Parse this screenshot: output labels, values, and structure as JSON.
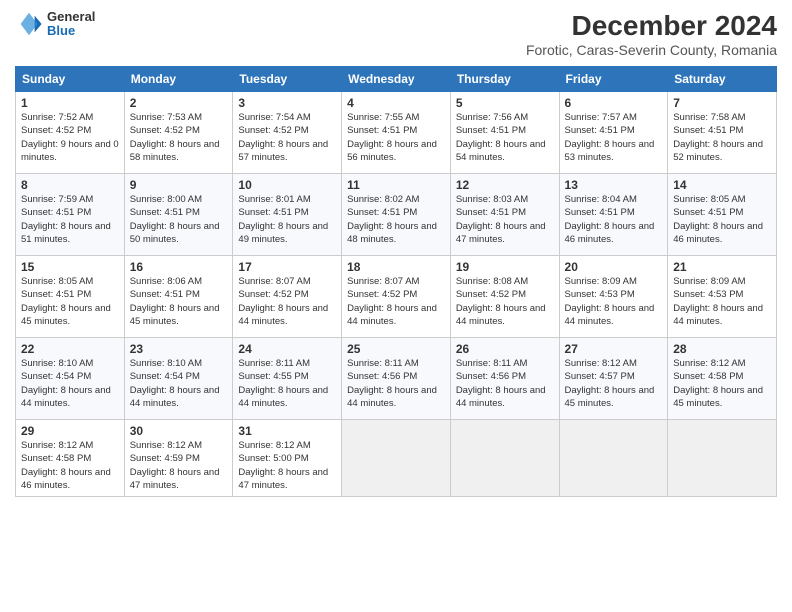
{
  "header": {
    "logo": {
      "general": "General",
      "blue": "Blue"
    },
    "title": "December 2024",
    "subtitle": "Forotic, Caras-Severin County, Romania"
  },
  "calendar": {
    "days_of_week": [
      "Sunday",
      "Monday",
      "Tuesday",
      "Wednesday",
      "Thursday",
      "Friday",
      "Saturday"
    ],
    "weeks": [
      [
        {
          "day": "1",
          "sunrise": "7:52 AM",
          "sunset": "4:52 PM",
          "daylight": "9 hours and 0 minutes."
        },
        {
          "day": "2",
          "sunrise": "7:53 AM",
          "sunset": "4:52 PM",
          "daylight": "8 hours and 58 minutes."
        },
        {
          "day": "3",
          "sunrise": "7:54 AM",
          "sunset": "4:52 PM",
          "daylight": "8 hours and 57 minutes."
        },
        {
          "day": "4",
          "sunrise": "7:55 AM",
          "sunset": "4:51 PM",
          "daylight": "8 hours and 56 minutes."
        },
        {
          "day": "5",
          "sunrise": "7:56 AM",
          "sunset": "4:51 PM",
          "daylight": "8 hours and 54 minutes."
        },
        {
          "day": "6",
          "sunrise": "7:57 AM",
          "sunset": "4:51 PM",
          "daylight": "8 hours and 53 minutes."
        },
        {
          "day": "7",
          "sunrise": "7:58 AM",
          "sunset": "4:51 PM",
          "daylight": "8 hours and 52 minutes."
        }
      ],
      [
        {
          "day": "8",
          "sunrise": "7:59 AM",
          "sunset": "4:51 PM",
          "daylight": "8 hours and 51 minutes."
        },
        {
          "day": "9",
          "sunrise": "8:00 AM",
          "sunset": "4:51 PM",
          "daylight": "8 hours and 50 minutes."
        },
        {
          "day": "10",
          "sunrise": "8:01 AM",
          "sunset": "4:51 PM",
          "daylight": "8 hours and 49 minutes."
        },
        {
          "day": "11",
          "sunrise": "8:02 AM",
          "sunset": "4:51 PM",
          "daylight": "8 hours and 48 minutes."
        },
        {
          "day": "12",
          "sunrise": "8:03 AM",
          "sunset": "4:51 PM",
          "daylight": "8 hours and 47 minutes."
        },
        {
          "day": "13",
          "sunrise": "8:04 AM",
          "sunset": "4:51 PM",
          "daylight": "8 hours and 46 minutes."
        },
        {
          "day": "14",
          "sunrise": "8:05 AM",
          "sunset": "4:51 PM",
          "daylight": "8 hours and 46 minutes."
        }
      ],
      [
        {
          "day": "15",
          "sunrise": "8:05 AM",
          "sunset": "4:51 PM",
          "daylight": "8 hours and 45 minutes."
        },
        {
          "day": "16",
          "sunrise": "8:06 AM",
          "sunset": "4:51 PM",
          "daylight": "8 hours and 45 minutes."
        },
        {
          "day": "17",
          "sunrise": "8:07 AM",
          "sunset": "4:52 PM",
          "daylight": "8 hours and 44 minutes."
        },
        {
          "day": "18",
          "sunrise": "8:07 AM",
          "sunset": "4:52 PM",
          "daylight": "8 hours and 44 minutes."
        },
        {
          "day": "19",
          "sunrise": "8:08 AM",
          "sunset": "4:52 PM",
          "daylight": "8 hours and 44 minutes."
        },
        {
          "day": "20",
          "sunrise": "8:09 AM",
          "sunset": "4:53 PM",
          "daylight": "8 hours and 44 minutes."
        },
        {
          "day": "21",
          "sunrise": "8:09 AM",
          "sunset": "4:53 PM",
          "daylight": "8 hours and 44 minutes."
        }
      ],
      [
        {
          "day": "22",
          "sunrise": "8:10 AM",
          "sunset": "4:54 PM",
          "daylight": "8 hours and 44 minutes."
        },
        {
          "day": "23",
          "sunrise": "8:10 AM",
          "sunset": "4:54 PM",
          "daylight": "8 hours and 44 minutes."
        },
        {
          "day": "24",
          "sunrise": "8:11 AM",
          "sunset": "4:55 PM",
          "daylight": "8 hours and 44 minutes."
        },
        {
          "day": "25",
          "sunrise": "8:11 AM",
          "sunset": "4:56 PM",
          "daylight": "8 hours and 44 minutes."
        },
        {
          "day": "26",
          "sunrise": "8:11 AM",
          "sunset": "4:56 PM",
          "daylight": "8 hours and 44 minutes."
        },
        {
          "day": "27",
          "sunrise": "8:12 AM",
          "sunset": "4:57 PM",
          "daylight": "8 hours and 45 minutes."
        },
        {
          "day": "28",
          "sunrise": "8:12 AM",
          "sunset": "4:58 PM",
          "daylight": "8 hours and 45 minutes."
        }
      ],
      [
        {
          "day": "29",
          "sunrise": "8:12 AM",
          "sunset": "4:58 PM",
          "daylight": "8 hours and 46 minutes."
        },
        {
          "day": "30",
          "sunrise": "8:12 AM",
          "sunset": "4:59 PM",
          "daylight": "8 hours and 47 minutes."
        },
        {
          "day": "31",
          "sunrise": "8:12 AM",
          "sunset": "5:00 PM",
          "daylight": "8 hours and 47 minutes."
        },
        null,
        null,
        null,
        null
      ]
    ]
  }
}
